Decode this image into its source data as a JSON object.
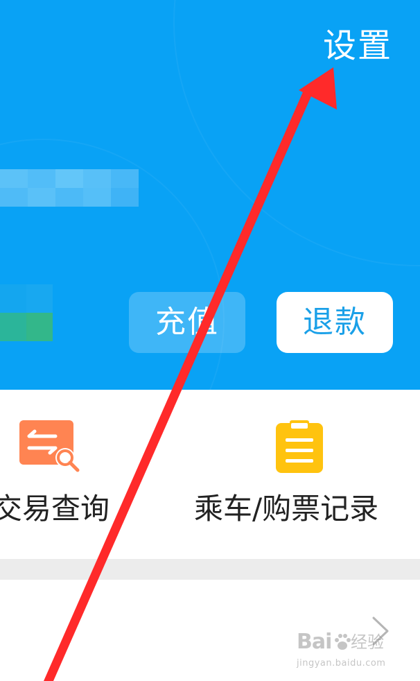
{
  "header": {
    "settings_label": "设置",
    "background_color": "#09a2f5"
  },
  "actions": {
    "recharge_label": "充值",
    "refund_label": "退款"
  },
  "shortcuts": [
    {
      "label": "交易查询",
      "icon": "transaction-search-icon",
      "icon_color": "#ff8452"
    },
    {
      "label": "乘车/购票记录",
      "icon": "clipboard-icon",
      "icon_color": "#ffc30f"
    }
  ],
  "list": {
    "chevron_icon": "chevron-right-icon"
  },
  "watermark": {
    "logo": "Bai",
    "suffix": "经验",
    "url": "jingyan.baidu.com"
  },
  "annotation": {
    "arrow_color": "#ff2a2a"
  }
}
